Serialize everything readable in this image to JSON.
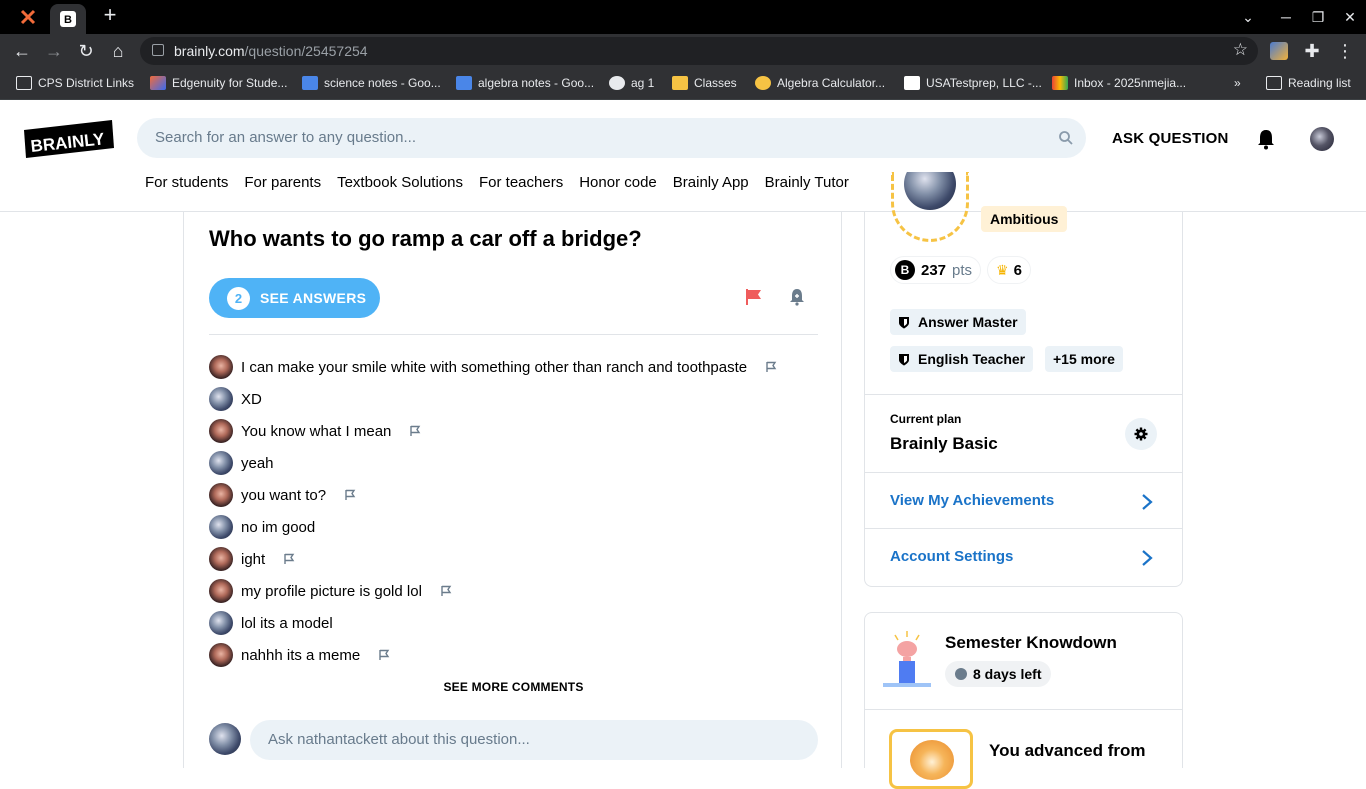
{
  "browser": {
    "url_host": "brainly.com",
    "url_path": "/question/25457254",
    "bookmarks": [
      "CPS District Links",
      "Edgenuity for Stude...",
      "science notes - Goo...",
      "algebra notes - Goo...",
      "ag 1",
      "Classes",
      "Algebra Calculator...",
      "USATestprep, LLC -...",
      "Inbox - 2025nmejia...",
      "Reading list"
    ],
    "more_bookmarks": "»"
  },
  "header": {
    "logo_text": "BRAINLY",
    "search_placeholder": "Search for an answer to any question...",
    "ask_question": "ASK QUESTION",
    "nav": [
      "For students",
      "For parents",
      "Textbook Solutions",
      "For teachers",
      "Honor code",
      "Brainly App",
      "Brainly Tutor"
    ]
  },
  "question": {
    "title": "Who wants to go ramp a car off a bridge?",
    "answers_count": "2",
    "see_answers": "SEE ANSWERS",
    "comments": [
      {
        "text": "I can make your smile white with something other than ranch and toothpaste",
        "avatar": "girl",
        "flag": true
      },
      {
        "text": "XD",
        "avatar": "earth",
        "flag": false
      },
      {
        "text": "You know what I mean",
        "avatar": "girl",
        "flag": true
      },
      {
        "text": "yeah",
        "avatar": "earth",
        "flag": false
      },
      {
        "text": "you want to?",
        "avatar": "girl",
        "flag": true
      },
      {
        "text": "no im good",
        "avatar": "earth",
        "flag": false
      },
      {
        "text": "ight",
        "avatar": "girl",
        "flag": true
      },
      {
        "text": "my profile picture is gold lol",
        "avatar": "girl",
        "flag": true
      },
      {
        "text": "lol its a model",
        "avatar": "earth",
        "flag": false
      },
      {
        "text": "nahhh its a meme",
        "avatar": "girl",
        "flag": true
      }
    ],
    "see_more_comments": "SEE MORE COMMENTS",
    "ask_placeholder": "Ask nathantackett about this question..."
  },
  "profile": {
    "rank": "Ambitious",
    "points": "237",
    "points_unit": "pts",
    "crowns": "6",
    "badges": [
      "Answer Master",
      "English Teacher"
    ],
    "more_badges": "+15 more",
    "plan_label": "Current plan",
    "plan_name": "Brainly Basic",
    "link_achievements": "View My Achievements",
    "link_settings": "Account Settings"
  },
  "semester": {
    "title": "Semester Knowdown",
    "days_left": "8 days left",
    "advanced_text": "You advanced from"
  },
  "colors": {
    "accent_blue": "#4fb3f6",
    "link_blue": "#1a73c8",
    "flag_red": "#ef5c5c",
    "search_bg": "#ebf2f7"
  }
}
